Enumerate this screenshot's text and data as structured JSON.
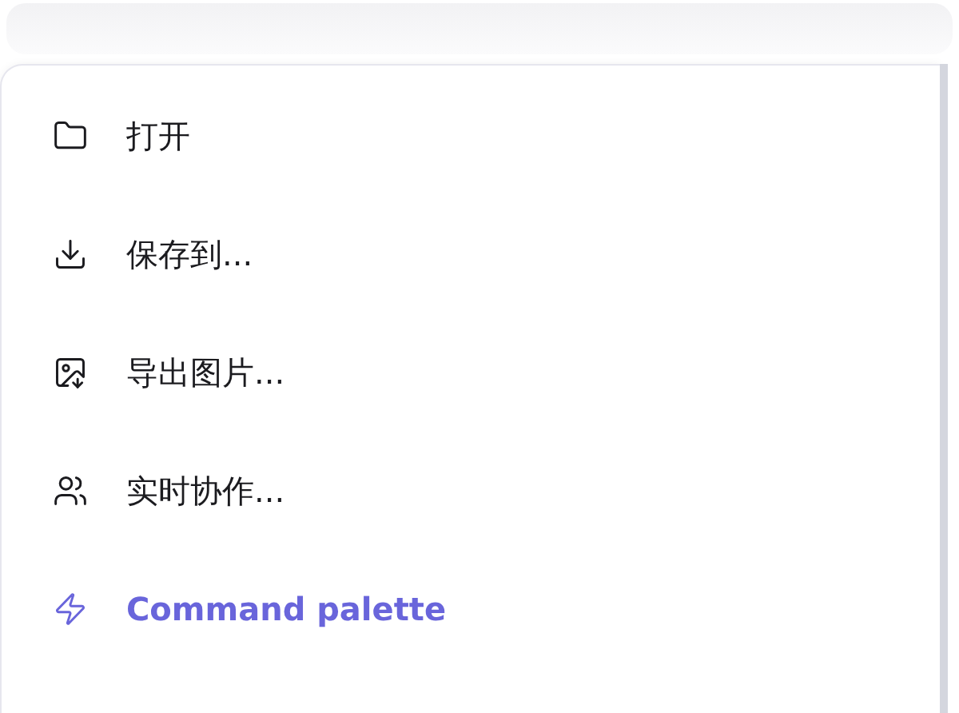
{
  "menu": {
    "items": [
      {
        "label": "打开",
        "kind": "normal"
      },
      {
        "label": "保存到...",
        "kind": "normal"
      },
      {
        "label": "导出图片...",
        "kind": "normal"
      },
      {
        "label": "实时协作...",
        "kind": "normal"
      },
      {
        "label": "Command palette",
        "kind": "accent"
      }
    ]
  }
}
